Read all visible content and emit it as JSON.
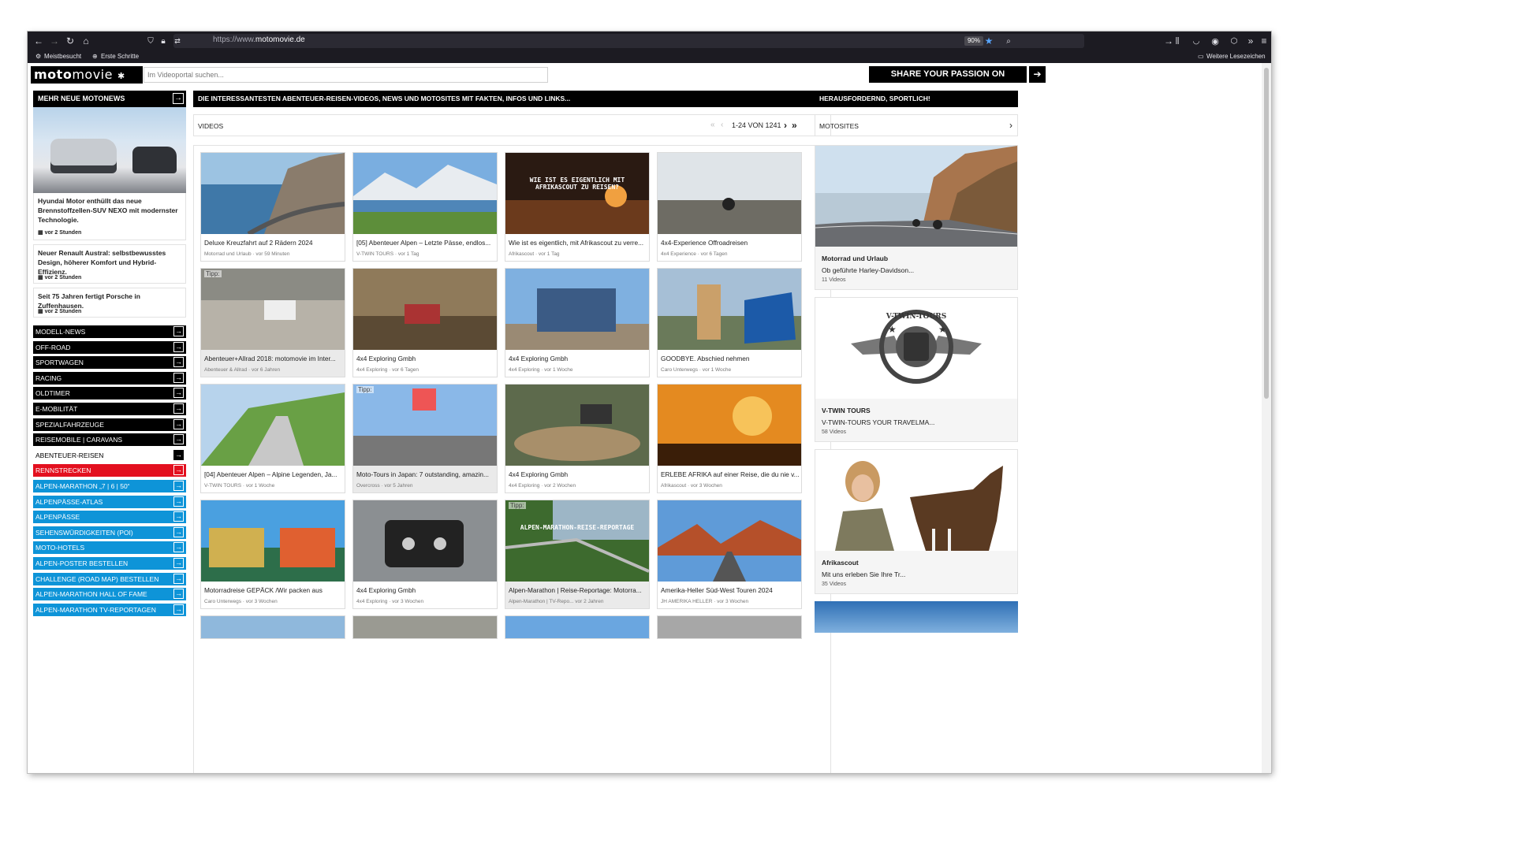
{
  "browser": {
    "url_prefix": "https://www.",
    "url_domain": "motomovie.de",
    "zoom": "90%",
    "bookmarks": [
      "Meistbesucht",
      "Erste Schritte"
    ],
    "other_bookmarks": "Weitere Lesezeichen"
  },
  "header": {
    "logo_bold": "moto",
    "logo_light": "movie",
    "search_placeholder": "Im Videoportal suchen...",
    "share_label": "SHARE YOUR PASSION ON MOTOMOVIE"
  },
  "left": {
    "title": "MEHR NEUE MOTONEWS",
    "news": [
      {
        "title": "Hyundai Motor enthüllt das neue Brennstoffzellen-SUV NEXO mit modernster Technologie.",
        "time": "vor 2 Stunden"
      },
      {
        "title": "Neuer Renault Austral: selbstbewusstes Design, höherer Komfort und Hybrid-Effizienz.",
        "time": "vor 2 Stunden"
      },
      {
        "title": "Seit 75 Jahren fertigt Porsche in Zuffenhausen.",
        "time": "vor 2 Stunden"
      }
    ],
    "menu": [
      {
        "label": "MODELL-NEWS",
        "style": "black"
      },
      {
        "label": "OFF-ROAD",
        "style": "black"
      },
      {
        "label": "SPORTWAGEN",
        "style": "black"
      },
      {
        "label": "RACING",
        "style": "black"
      },
      {
        "label": "OLDTIMER",
        "style": "black"
      },
      {
        "label": "E-MOBILITÄT",
        "style": "black"
      },
      {
        "label": "SPEZIALFAHRZEUGE",
        "style": "black"
      },
      {
        "label": "REISEMOBILE | CARAVANS",
        "style": "black"
      },
      {
        "label": "ABENTEUER-REISEN",
        "style": "white"
      },
      {
        "label": "RENNSTRECKEN",
        "style": "red"
      },
      {
        "label": "ALPEN-MARATHON „7 | 6 | 50“",
        "style": "blue"
      },
      {
        "label": "ALPENPÄSSE-ATLAS",
        "style": "blue"
      },
      {
        "label": "ALPENPÄSSE",
        "style": "blue"
      },
      {
        "label": "SEHENSWÜRDIGKEITEN (POI)",
        "style": "blue"
      },
      {
        "label": "MOTO-HOTELS",
        "style": "blue"
      },
      {
        "label": "ALPEN-POSTER BESTELLEN",
        "style": "blue"
      },
      {
        "label": "CHALLENGE (ROAD MAP) BESTELLEN",
        "style": "blue"
      },
      {
        "label": "ALPEN-MARATHON HALL OF FAME",
        "style": "blue"
      },
      {
        "label": "ALPEN-MARATHON TV-REPORTAGEN",
        "style": "blue"
      }
    ],
    "colors": {
      "black": "#000000",
      "red": "#e3101f",
      "blue": "#0e94d8"
    }
  },
  "center": {
    "title": "DIE INTERESSANTESTEN ABENTEUER-REISEN-VIDEOS, NEWS UND MOTOSITES MIT FAKTEN, INFOS UND LINKS...",
    "section": "VIDEOS",
    "pagination": "1-24 VON 1241",
    "tipp_label": "Tipp:",
    "videos": [
      {
        "title": "Deluxe Kreuzfahrt auf 2 Rädern 2024",
        "meta": "Motorrad und Urlaub · vor 59 Minuten",
        "tipp": false
      },
      {
        "title": "[05] Abenteuer Alpen – Letzte Pässe, endlos...",
        "meta": "V-TWIN TOURS · vor 1 Tag",
        "tipp": false
      },
      {
        "title": "Wie ist es eigentlich, mit Afrikascout zu verre...",
        "meta": "Afrikascout · vor 1 Tag",
        "tipp": false,
        "overlay": "WIE IST ES EIGENTLICH MIT AFRIKASCOUT ZU REISEN?"
      },
      {
        "title": "4x4-Experience Offroadreisen",
        "meta": "4x4 Experience · vor 6 Tagen",
        "tipp": false
      },
      {
        "title": "Abenteuer+Allrad 2018: motomovie im Inter...",
        "meta": "Abenteuer & Allrad · vor 6 Jahren",
        "tipp": true
      },
      {
        "title": "4x4 Exploring Gmbh",
        "meta": "4x4 Exploring · vor 6 Tagen",
        "tipp": false
      },
      {
        "title": "4x4 Exploring Gmbh",
        "meta": "4x4 Exploring · vor 1 Woche",
        "tipp": false
      },
      {
        "title": "GOODBYE. Abschied nehmen",
        "meta": "Caro Unterwegs · vor 1 Woche",
        "tipp": false
      },
      {
        "title": "[04] Abenteuer Alpen – Alpine Legenden, Ja...",
        "meta": "V-TWIN TOURS · vor 1 Woche",
        "tipp": false
      },
      {
        "title": "Moto-Tours in Japan: 7 outstanding, amazin...",
        "meta": "Overcross · vor 5 Jahren",
        "tipp": true
      },
      {
        "title": "4x4 Exploring Gmbh",
        "meta": "4x4 Exploring · vor 2 Wochen",
        "tipp": false
      },
      {
        "title": "ERLEBE AFRIKA auf einer Reise, die du nie v...",
        "meta": "Afrikascout · vor 3 Wochen",
        "tipp": false
      },
      {
        "title": "Motorradreise GEPÄCK /Wir packen aus",
        "meta": "Caro Unterwegs · vor 3 Wochen",
        "tipp": false
      },
      {
        "title": "4x4 Exploring Gmbh",
        "meta": "4x4 Exploring · vor 3 Wochen",
        "tipp": false
      },
      {
        "title": "Alpen-Marathon | Reise-Reportage: Motorra...",
        "meta": "Alpen-Marathon | TV-Repo... vor 2 Jahren",
        "tipp": true,
        "overlay": "ALPEN-MARATHON-REISE-REPORTAGE"
      },
      {
        "title": "Amerika-Heller Süd-West Touren 2024",
        "meta": "JH AMERIKA HELLER · vor 3 Wochen",
        "tipp": false
      }
    ]
  },
  "right": {
    "title": "HERAUSFORDERND, SPORTLICH!",
    "section": "MOTOSITES",
    "sites": [
      {
        "title": "Motorrad und Urlaub",
        "sub": "Ob geführte Harley-Davidson...",
        "count": "11 Videos"
      },
      {
        "title": "V-TWIN TOURS",
        "sub": "V-TWIN-TOURS YOUR TRAVELMA...",
        "count": "58 Videos",
        "logo_text": "V-TWIN-TOURS"
      },
      {
        "title": "Afrikascout",
        "sub": "Mit uns erleben Sie Ihre Tr...",
        "count": "35 Videos"
      }
    ]
  }
}
